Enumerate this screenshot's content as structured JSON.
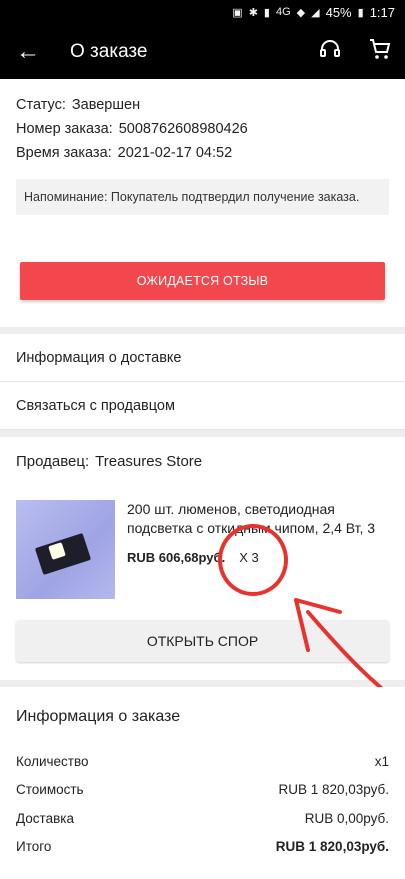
{
  "statusbar": {
    "battery": "45%",
    "time": "1:17",
    "network": "4G"
  },
  "appbar": {
    "title": "О заказе"
  },
  "order": {
    "status_label": "Статус:",
    "status_value": "Завершен",
    "number_label": "Номер заказа:",
    "number_value": "5008762608980426",
    "time_label": "Время заказа:",
    "time_value": "2021-02-17 04:52",
    "reminder": "Напоминание: Покупатель подтвердил получение заказа.",
    "await_button": "ОЖИДАЕТСЯ ОТЗЫВ"
  },
  "links": {
    "delivery": "Информация о доставке",
    "contact": "Связаться с продавцом"
  },
  "seller": {
    "label": "Продавец:",
    "name": "Treasures Store",
    "product_name": "200 шт. люменов, светодиодная подсветка с откидным чипом, 2,4 Вт, 3 ...",
    "price": "RUB 606,68руб.",
    "qty": "X 3",
    "dispute_button": "ОТКРЫТЬ СПОР"
  },
  "order_info": {
    "title": "Информация о заказе",
    "rows": [
      {
        "label": "Количество",
        "value": "x1"
      },
      {
        "label": "Стоимость",
        "value": "RUB 1 820,03руб."
      },
      {
        "label": "Доставка",
        "value": "RUB 0,00руб."
      },
      {
        "label": "Итого",
        "value": "RUB 1 820,03руб."
      }
    ]
  },
  "colors": {
    "accent": "#f2474d",
    "annotation": "#e8322e",
    "bar": "#000000"
  }
}
